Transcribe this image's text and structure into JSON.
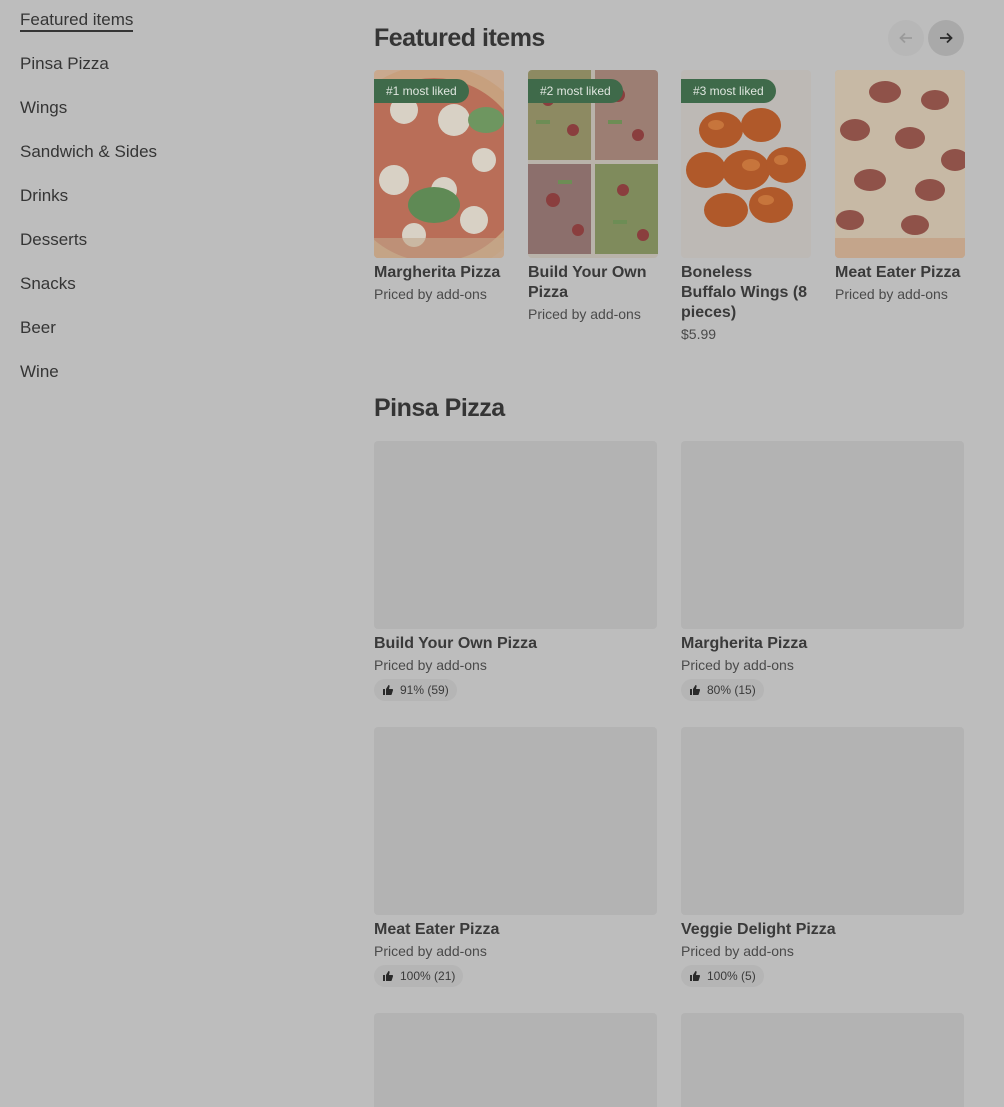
{
  "sidebar": {
    "items": [
      {
        "label": "Featured items",
        "active": true
      },
      {
        "label": "Pinsa Pizza"
      },
      {
        "label": "Wings"
      },
      {
        "label": "Sandwich & Sides"
      },
      {
        "label": "Drinks"
      },
      {
        "label": "Desserts"
      },
      {
        "label": "Snacks"
      },
      {
        "label": "Beer"
      },
      {
        "label": "Wine"
      }
    ]
  },
  "featured": {
    "title": "Featured items",
    "prev_icon": "arrow-left-icon",
    "next_icon": "arrow-right-icon",
    "items": [
      {
        "badge": "#1 most liked",
        "name": "Margherita Pizza",
        "price": "Priced by add-ons"
      },
      {
        "badge": "#2 most liked",
        "name": "Build Your Own Pizza",
        "price": "Priced by add-ons"
      },
      {
        "badge": "#3 most liked",
        "name": "Boneless Buffalo Wings (8 pieces)",
        "price": "$5.99"
      },
      {
        "name": "Meat Eater Pizza",
        "price": "Priced by add-ons"
      }
    ]
  },
  "pinsa": {
    "title": "Pinsa Pizza",
    "items": [
      {
        "name": "Build Your Own Pizza",
        "price": "Priced by add-ons",
        "rating": "91% (59)"
      },
      {
        "name": "Margherita Pizza",
        "price": "Priced by add-ons",
        "rating": "80% (15)"
      },
      {
        "name": "Meat Eater Pizza",
        "price": "Priced by add-ons",
        "rating": "100% (21)"
      },
      {
        "name": "Veggie Delight Pizza",
        "price": "Priced by add-ons",
        "rating": "100% (5)"
      },
      {},
      {}
    ]
  },
  "colors": {
    "badge": "#3f6a4a",
    "overlay_bg": "#bdbdbd"
  }
}
